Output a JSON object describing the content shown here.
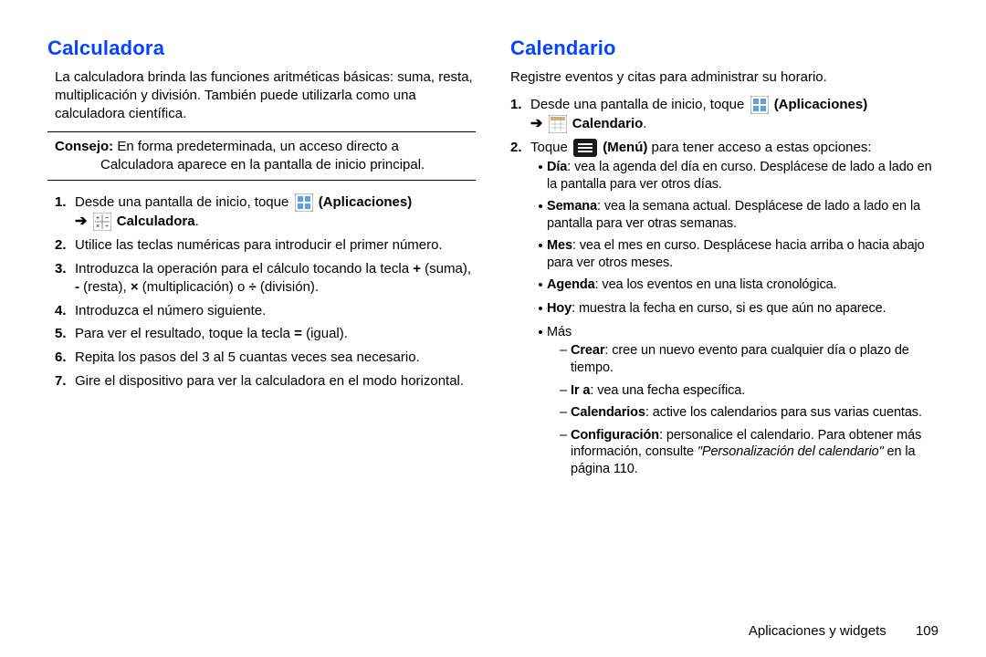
{
  "left": {
    "heading": "Calculadora",
    "intro": "La calculadora brinda las funciones aritméticas básicas: suma, resta, multiplicación y división. También puede utilizarla como una calculadora científica.",
    "tip_label": "Consejo:",
    "tip_body": "En forma predeterminada, un acceso directo a Calculadora aparece en la pantalla de inicio principal.",
    "apps_label": "(Aplicaciones)",
    "calc_label": "Calculadora",
    "steps": [
      "Desde una pantalla de inicio, toque ",
      "Utilice las teclas numéricas para introducir el primer número.",
      "Introduzca la operación para el cálculo tocando la tecla + (suma), - (resta), × (multiplicación) o ÷ (división).",
      "Introduzca el número siguiente.",
      "Para ver el resultado, toque la tecla = (igual).",
      "Repita los pasos del 3 al 5 cuantas veces sea necesario.",
      "Gire el dispositivo para ver la calculadora en el modo horizontal."
    ],
    "step3_pre": "Introduzca la operación para el cálculo tocando la tecla ",
    "step3_plus": "+",
    "step3_suma": " (suma), ",
    "step3_minus": "-",
    "step3_resta": " (resta), ",
    "step3_times": "×",
    "step3_mult": " (multiplicación) o ",
    "step3_div": "÷",
    "step3_end": " (división).",
    "step5_pre": "Para ver el resultado, toque la tecla ",
    "step5_eq": "=",
    "step5_end": " (igual)."
  },
  "right": {
    "heading": "Calendario",
    "intro": "Registre eventos y citas para administrar su horario.",
    "apps_label": "(Aplicaciones)",
    "cal_label": "Calendario",
    "menu_label": "(Menú)",
    "step1_pre": "Desde una pantalla de inicio, toque ",
    "step2_pre": "Toque ",
    "step2_post": " para tener acceso a estas opciones:",
    "bullets": [
      {
        "term": "Día",
        "text": ": vea la agenda del día en curso. Desplácese de lado a lado en la pantalla para ver otros días."
      },
      {
        "term": "Semana",
        "text": ": vea la semana actual. Desplácese de lado a lado en la pantalla para ver otras semanas."
      },
      {
        "term": "Mes",
        "text": ": vea el mes en curso. Desplácese hacia arriba o hacia abajo para ver otros meses."
      },
      {
        "term": "Agenda",
        "text": ": vea los eventos en una lista cronológica."
      },
      {
        "term": "Hoy",
        "text": ": muestra la fecha en curso, si es que aún no aparece."
      }
    ],
    "more_label": "Más",
    "sub": [
      {
        "term": "Crear",
        "text": ": cree un nuevo evento para cualquier día o plazo de tiempo."
      },
      {
        "term": "Ir a",
        "text": ": vea una fecha específica."
      },
      {
        "term": "Calendarios",
        "text": ": active los calendarios para sus varias cuentas."
      }
    ],
    "config_term": "Configuración",
    "config_pre": ": personalice el calendario. Para obtener más información, consulte ",
    "config_link": "\"Personalización del calendario\"",
    "config_post": " en la página 110."
  },
  "footer": {
    "section": "Aplicaciones y widgets",
    "page": "109"
  },
  "arrow_glyph": "➔"
}
